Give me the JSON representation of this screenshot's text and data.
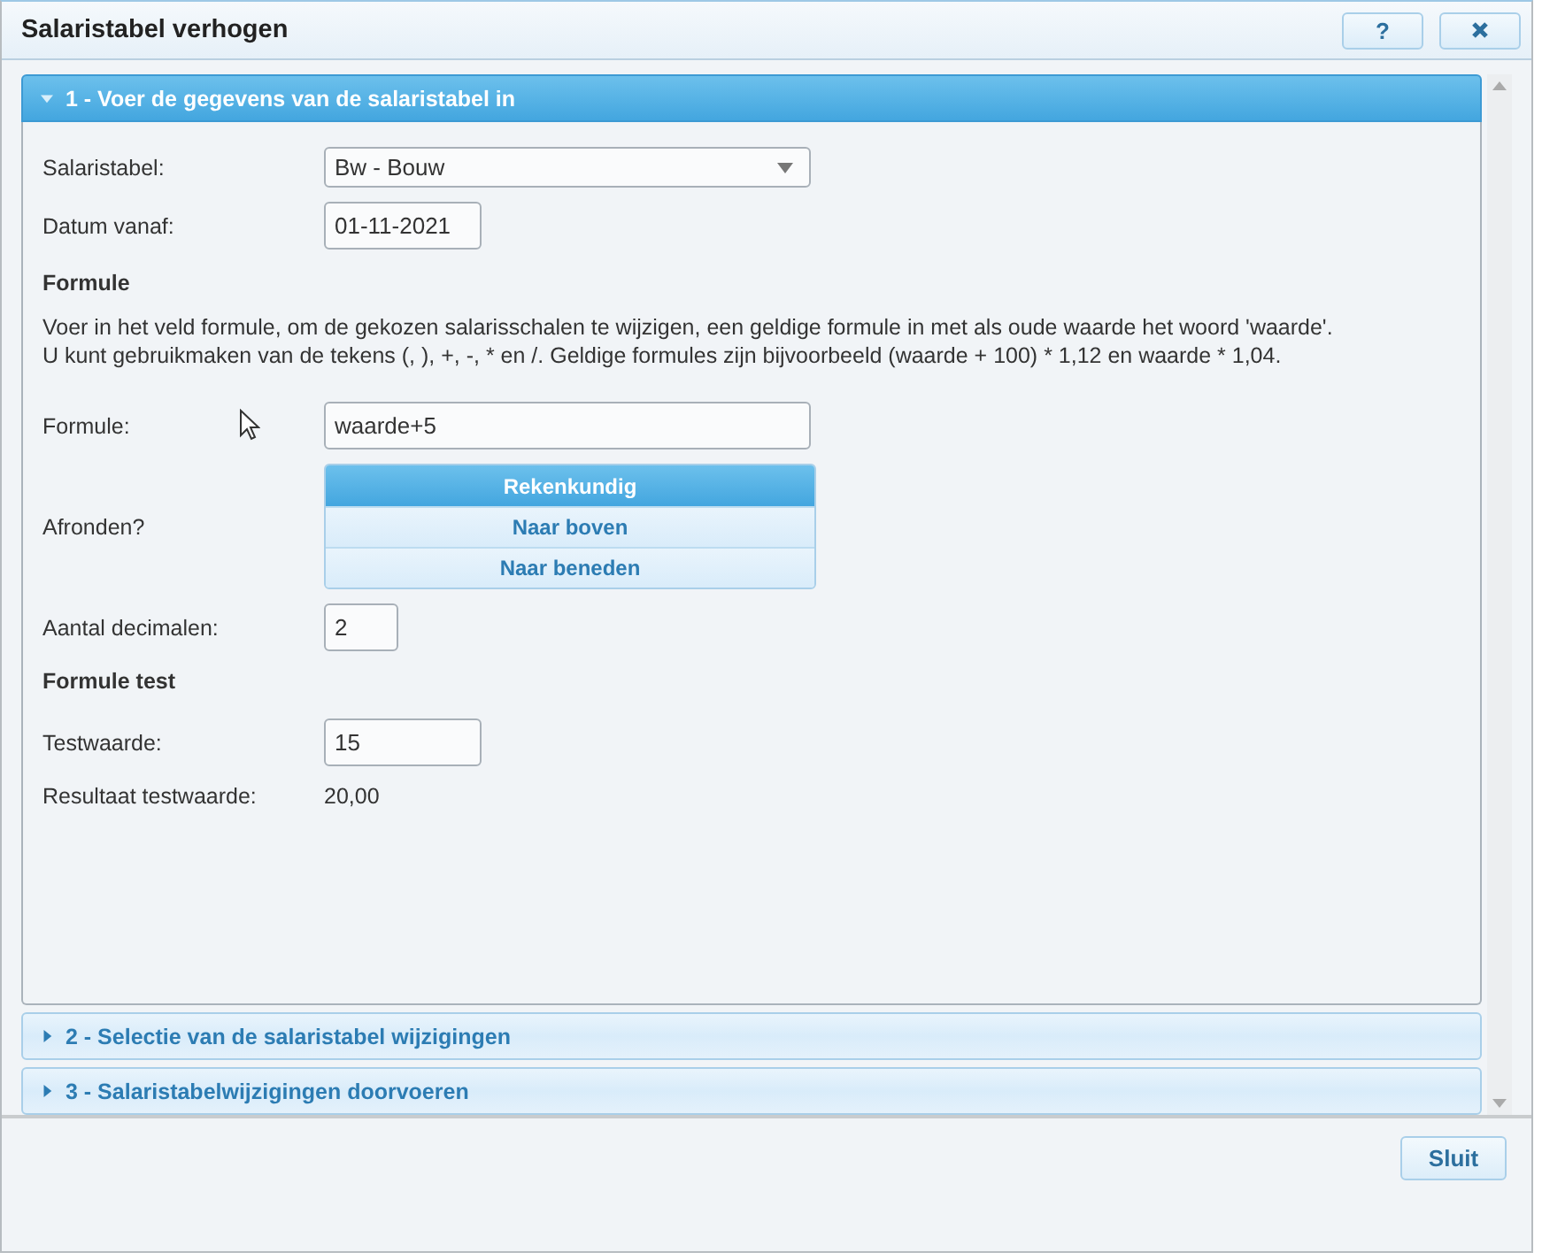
{
  "window": {
    "title": "Salaristabel verhogen",
    "help_button": "?"
  },
  "sections": [
    {
      "title": "1 - Voer de gegevens van de salaristabel in",
      "expanded": true,
      "rows": [
        {
          "kind": "select",
          "label": "Salaristabel:",
          "value": "Bw - Bouw"
        },
        {
          "kind": "input",
          "label": "Datum vanaf:",
          "value": "01-11-2021"
        },
        {
          "kind": "heading",
          "text": "Formule"
        },
        {
          "kind": "text",
          "lines": [
            "Voer in het veld formule, om de gekozen salarisschalen te wijzigen, een geldige formule in met als oude waarde het woord 'waarde'.",
            "U kunt gebruikmaken van de tekens (, ), +, -, * en /. Geldige formules zijn bijvoorbeeld (waarde + 100) * 1,12 en waarde * 1,04."
          ]
        },
        {
          "kind": "wide-input",
          "label": "Formule:",
          "value": "waarde+5"
        },
        {
          "kind": "options",
          "label": "Afronden?",
          "options": [
            {
              "label": "Rekenkundig",
              "selected": true
            },
            {
              "label": "Naar boven",
              "selected": false
            },
            {
              "label": "Naar beneden",
              "selected": false
            }
          ]
        },
        {
          "kind": "narrow-input",
          "label": "Aantal decimalen:",
          "value": "2"
        },
        {
          "kind": "heading",
          "text": "Formule test"
        },
        {
          "kind": "input",
          "label": "Testwaarde:",
          "value": "15"
        },
        {
          "kind": "readout",
          "label": "Resultaat testwaarde:",
          "value": "20,00"
        }
      ]
    },
    {
      "title": "2 - Selectie van de salaristabel wijzigingen",
      "expanded": false
    },
    {
      "title": "3 - Salaristabelwijzigingen doorvoeren",
      "expanded": false
    }
  ],
  "footer": {
    "close_button": "Sluit"
  }
}
